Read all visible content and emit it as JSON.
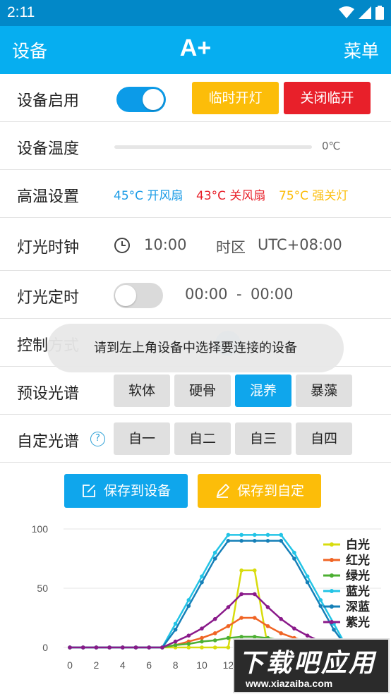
{
  "status_bar": {
    "time": "2:11"
  },
  "app_bar": {
    "left": "设备",
    "title": "A+",
    "right": "菜单"
  },
  "device_enable": {
    "label": "设备启用",
    "switch_on": true,
    "btn_temp_on": "临时开灯",
    "btn_temp_off": "关闭临开"
  },
  "device_temp": {
    "label": "设备温度",
    "value": "0℃"
  },
  "high_temp": {
    "label": "高温设置",
    "fan_on": "45°C 开风扇",
    "fan_off": "43°C 关风扇",
    "light_off": "75°C 强关灯",
    "colors": {
      "fan_on": "#1a9be6",
      "fan_off": "#e8202a",
      "light_off": "#fcbd09"
    }
  },
  "light_clock": {
    "label": "灯光时钟",
    "time": "10:00",
    "timezone_label": "时区",
    "timezone": "UTC+08:00"
  },
  "light_timer": {
    "label": "灯光定时",
    "switch_on": false,
    "start": "00:00",
    "sep": "-",
    "end": "00:00"
  },
  "control_mode": {
    "label": "控制方式"
  },
  "toast": "请到左上角设备中选择要连接的设备",
  "preset_spectrum": {
    "label": "预设光谱",
    "options": [
      "软体",
      "硬骨",
      "混养",
      "暴藻"
    ],
    "active_index": 2
  },
  "custom_spectrum": {
    "label": "自定光谱",
    "help": "?",
    "options": [
      "自一",
      "自二",
      "自三",
      "自四"
    ]
  },
  "actions": {
    "save_device": "保存到设备",
    "save_custom": "保存到自定"
  },
  "chart_data": {
    "type": "line",
    "x": [
      0,
      1,
      2,
      3,
      4,
      5,
      6,
      7,
      8,
      9,
      10,
      11,
      12,
      13,
      14,
      15,
      16,
      17,
      18,
      19,
      20,
      21,
      22,
      23,
      24
    ],
    "xticks": [
      "0",
      "2",
      "4",
      "6",
      "8",
      "10",
      "12"
    ],
    "yticks": [
      "0",
      "50",
      "100"
    ],
    "ylim": [
      0,
      100
    ],
    "legend_position": "top-right",
    "series": [
      {
        "name": "白光",
        "color": "#d8dc0e",
        "values": [
          0,
          0,
          0,
          0,
          0,
          0,
          0,
          0,
          0,
          0,
          0,
          0,
          0,
          65,
          65,
          0,
          0,
          0,
          0,
          0,
          0,
          0,
          0,
          0,
          0
        ]
      },
      {
        "name": "红光",
        "color": "#f06424",
        "values": [
          0,
          0,
          0,
          0,
          0,
          0,
          0,
          0,
          2,
          5,
          8,
          12,
          18,
          25,
          25,
          18,
          12,
          8,
          5,
          2,
          0,
          0,
          0,
          0,
          0
        ]
      },
      {
        "name": "绿光",
        "color": "#4caf32",
        "values": [
          0,
          0,
          0,
          0,
          0,
          0,
          0,
          0,
          2,
          3,
          5,
          6,
          8,
          9,
          9,
          8,
          6,
          5,
          3,
          2,
          0,
          0,
          0,
          0,
          0
        ]
      },
      {
        "name": "蓝光",
        "color": "#22c4e6",
        "values": [
          0,
          0,
          0,
          0,
          0,
          0,
          0,
          0,
          20,
          40,
          60,
          80,
          95,
          95,
          95,
          95,
          95,
          80,
          60,
          40,
          20,
          0,
          0,
          0,
          0
        ]
      },
      {
        "name": "深蓝",
        "color": "#1680b8",
        "values": [
          0,
          0,
          0,
          0,
          0,
          0,
          0,
          0,
          15,
          35,
          55,
          75,
          90,
          90,
          90,
          90,
          90,
          75,
          55,
          35,
          15,
          0,
          0,
          0,
          0
        ]
      },
      {
        "name": "紫光",
        "color": "#8a1a8a",
        "values": [
          0,
          0,
          0,
          0,
          0,
          0,
          0,
          0,
          5,
          10,
          16,
          24,
          34,
          45,
          45,
          34,
          24,
          16,
          10,
          5,
          0,
          0,
          0,
          0,
          0
        ]
      }
    ]
  },
  "watermark": {
    "big": "下载吧应用",
    "small": "www.xiazaiba.com"
  }
}
